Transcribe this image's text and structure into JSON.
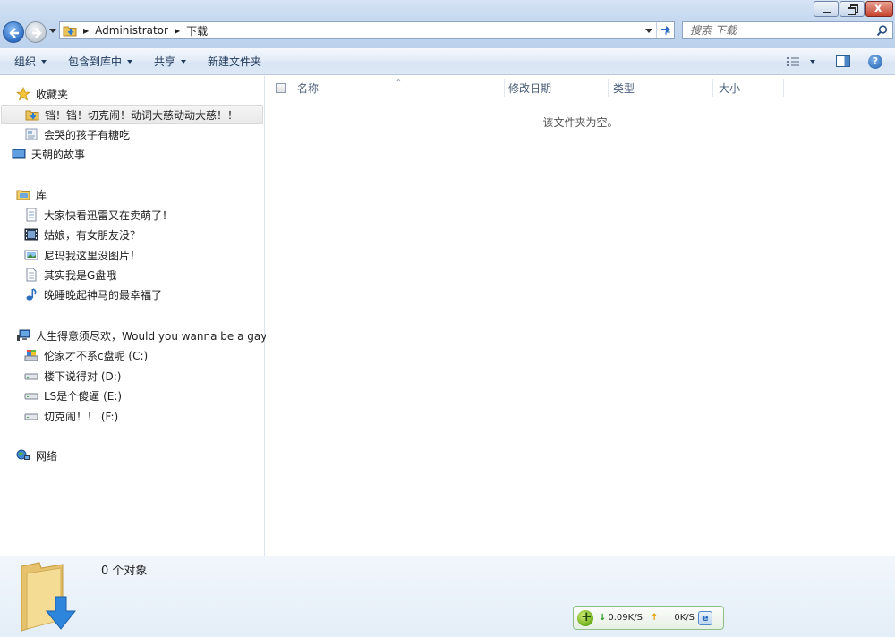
{
  "window": {
    "minimize_icon": "minimize-icon",
    "maximize_icon": "restore-icon",
    "close_icon": "close-icon"
  },
  "address_bar": {
    "crumbs": [
      "Administrator",
      "下载"
    ],
    "refresh_icon": "refresh-icon"
  },
  "search": {
    "placeholder": "搜索 下载",
    "icon": "search-icon"
  },
  "toolbar": {
    "organize": "组织",
    "include_in_library": "包含到库中",
    "share": "共享",
    "new_folder": "新建文件夹",
    "views_icon": "views-icon",
    "preview_icon": "preview-pane-icon",
    "help_icon": "help-icon"
  },
  "navigation": {
    "favorites": {
      "label": "收藏夹",
      "items": [
        "铛！铛！切克闹！动词大慈动动大慈！！",
        "会哭的孩子有糖吃",
        "天朝的故事"
      ]
    },
    "libraries": {
      "label": "库",
      "items": [
        "大家快看迅雷又在卖萌了！",
        "姑娘，有女朋友没？",
        "尼玛我这里没图片！",
        "其实我是G盘哦",
        "晚睡晚起神马的最幸福了"
      ]
    },
    "computer": {
      "label": "人生得意须尽欢，Would you wanna be a gay",
      "drives": [
        "伦家才不系c盘呢 (C:)",
        "楼下说得对 (D:)",
        "LS是个傻逼 (E:)",
        "切克闹！！ (F:)"
      ]
    },
    "network": {
      "label": "网络"
    }
  },
  "columns": {
    "name": "名称",
    "modified": "修改日期",
    "type": "类型",
    "size": "大小"
  },
  "empty_message": "该文件夹为空。",
  "details": {
    "count": "0 个对象"
  },
  "download_widget": {
    "down_speed": "0.09K/S",
    "up_speed": "0K/S",
    "down_arrow": "↓",
    "up_arrow": "↑"
  },
  "colors": {
    "accent": "#2f6fc5",
    "toolbar_text": "#1e395b",
    "header_text": "#4c607a"
  }
}
